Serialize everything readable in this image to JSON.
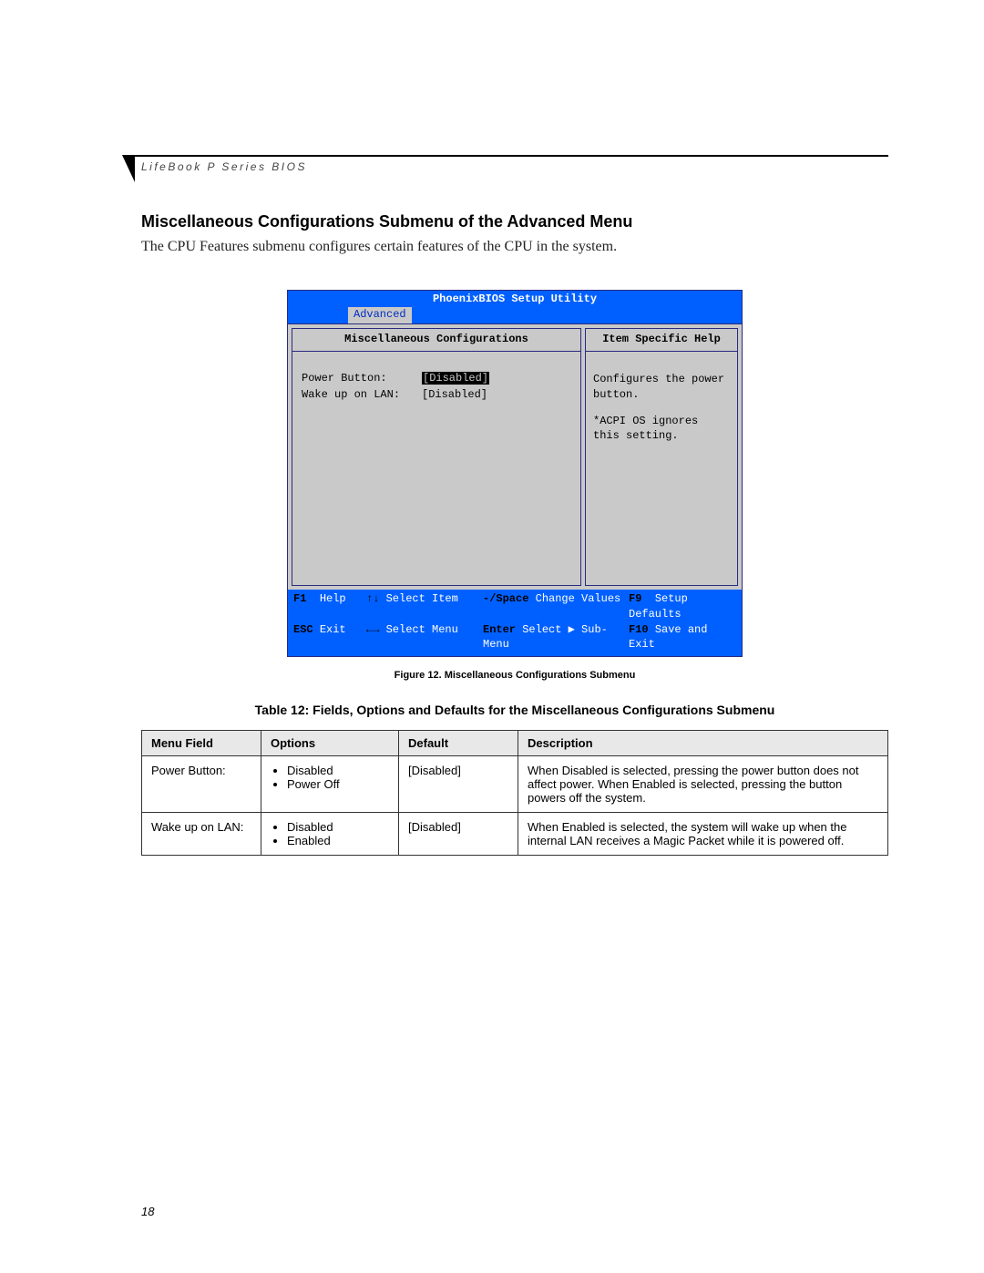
{
  "header": {
    "label": "LifeBook P Series BIOS"
  },
  "section": {
    "title": "Miscellaneous Configurations Submenu of the Advanced Menu",
    "intro": "The CPU Features submenu configures certain features of the CPU in the system."
  },
  "bios": {
    "title": "PhoenixBIOS Setup Utility",
    "active_tab": "Advanced",
    "panel_title": "Miscellaneous Configurations",
    "help_title": "Item Specific Help",
    "fields": [
      {
        "label": "Power Button:",
        "value": "[Disabled]",
        "selected": true
      },
      {
        "label": "Wake up on LAN:",
        "value": "[Disabled]",
        "selected": false
      }
    ],
    "help_text_1": "Configures the power button.",
    "help_text_2": "*ACPI OS ignores this setting.",
    "footer": {
      "r1": {
        "k1": "F1",
        "t1": "Help",
        "k2": "↑↓",
        "t2": "Select Item",
        "k3": "-/Space",
        "t3": "Change Values",
        "k4": "F9",
        "t4": "Setup Defaults"
      },
      "r2": {
        "k1": "ESC",
        "t1": "Exit",
        "k2": "←→",
        "t2": "Select Menu",
        "k3": "Enter",
        "t3": "Select ▶ Sub-Menu",
        "k4": "F10",
        "t4": "Save and Exit"
      }
    }
  },
  "figure_caption": "Figure 12.  Miscellaneous Configurations Submenu",
  "table": {
    "title": "Table 12: Fields, Options and Defaults for the Miscellaneous Configurations Submenu",
    "headers": {
      "c1": "Menu Field",
      "c2": "Options",
      "c3": "Default",
      "c4": "Description"
    },
    "rows": [
      {
        "field": "Power Button:",
        "options": [
          "Disabled",
          "Power Off"
        ],
        "default": "[Disabled]",
        "desc": "When Disabled is selected, pressing the power button does not affect power. When Enabled is selected, pressing the button powers off the system."
      },
      {
        "field": "Wake up on LAN:",
        "options": [
          "Disabled",
          "Enabled"
        ],
        "default": "[Disabled]",
        "desc": "When Enabled is selected, the system will wake up when the internal LAN receives a Magic Packet while it is powered off."
      }
    ]
  },
  "page_number": "18"
}
